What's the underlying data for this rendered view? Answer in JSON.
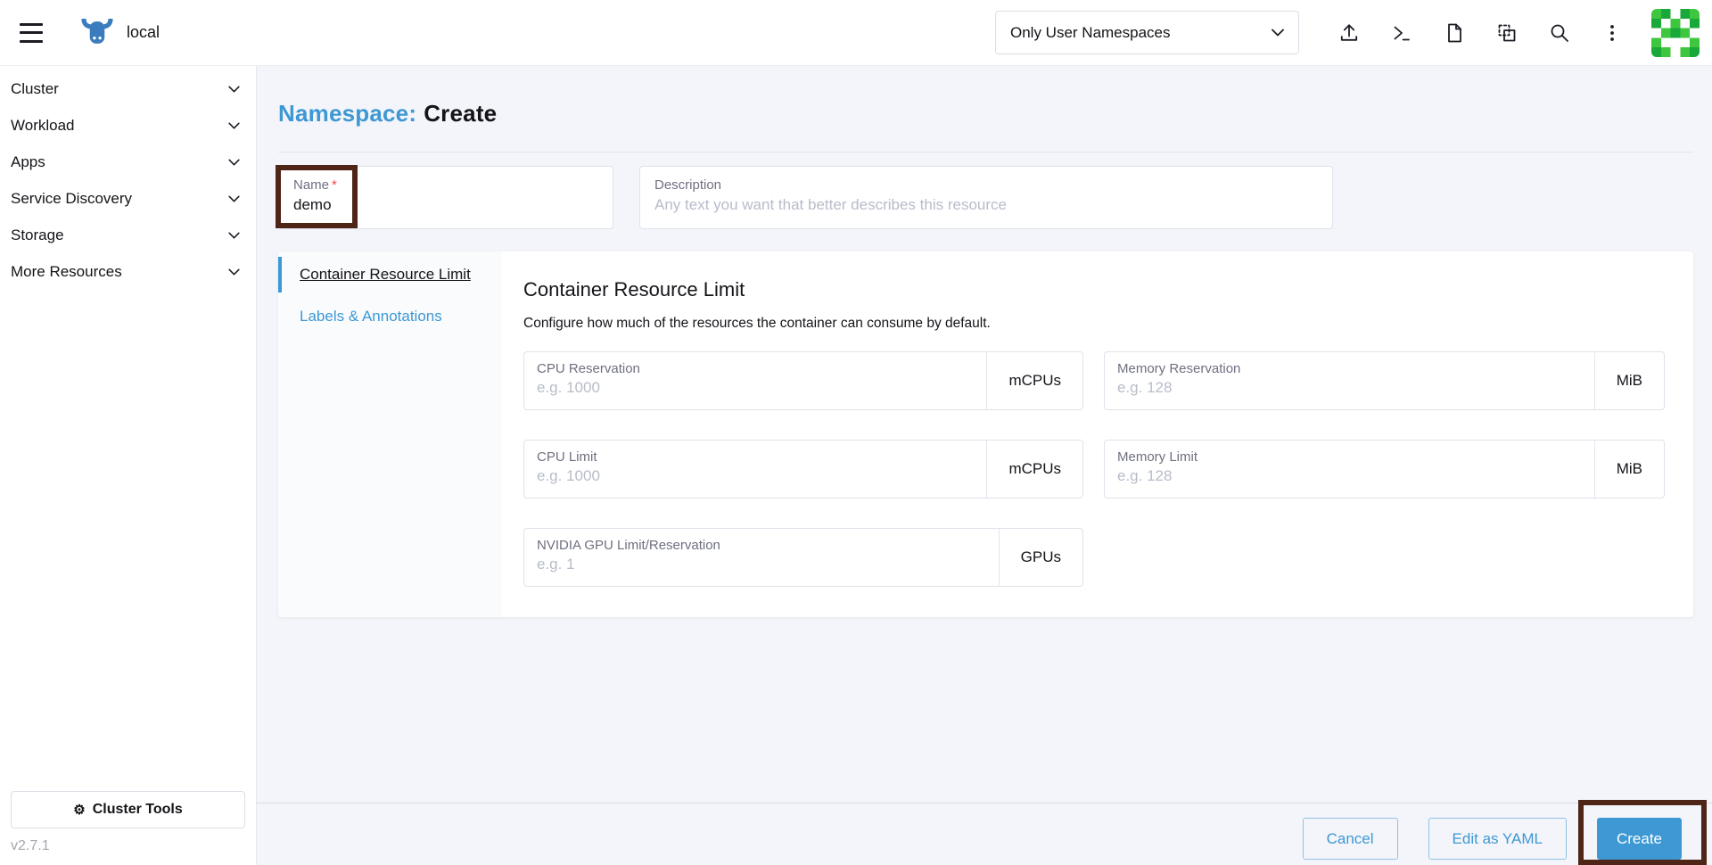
{
  "header": {
    "cluster": "local",
    "filter_value": "Only User Namespaces",
    "action_icons": [
      "import-yaml",
      "kubectl-shell",
      "kubeconfig-file",
      "copy-kubeconfig",
      "search",
      "kebab-menu"
    ]
  },
  "sidebar": {
    "items": [
      "Cluster",
      "Workload",
      "Apps",
      "Service Discovery",
      "Storage",
      "More Resources"
    ],
    "cluster_tools": "Cluster Tools",
    "gear_glyph": "⚙",
    "version": "v2.7.1"
  },
  "page": {
    "title_prefix": "Namespace:",
    "title_action": "Create"
  },
  "form": {
    "name": {
      "label": "Name",
      "required_mark": "*",
      "value": "demo"
    },
    "description": {
      "label": "Description",
      "placeholder": "Any text you want that better describes this resource"
    }
  },
  "tabs": [
    {
      "label": "Container Resource Limit"
    },
    {
      "label": "Labels & Annotations"
    }
  ],
  "section": {
    "heading": "Container Resource Limit",
    "description": "Configure how much of the resources the container can consume by default.",
    "fields": [
      {
        "label": "CPU Reservation",
        "placeholder": "e.g. 1000",
        "unit": "mCPUs"
      },
      {
        "label": "Memory Reservation",
        "placeholder": "e.g. 128",
        "unit": "MiB"
      },
      {
        "label": "CPU Limit",
        "placeholder": "e.g. 1000",
        "unit": "mCPUs"
      },
      {
        "label": "Memory Limit",
        "placeholder": "e.g. 128",
        "unit": "MiB"
      },
      {
        "label": "NVIDIA GPU Limit/Reservation",
        "placeholder": "e.g. 1",
        "unit": "GPUs"
      }
    ]
  },
  "footer": {
    "cancel": "Cancel",
    "edit_yaml": "Edit as YAML",
    "create": "Create"
  },
  "colors": {
    "primary": "#3d98d3",
    "annotation": "#4e2517",
    "page_bg": "#f4f5fa"
  }
}
